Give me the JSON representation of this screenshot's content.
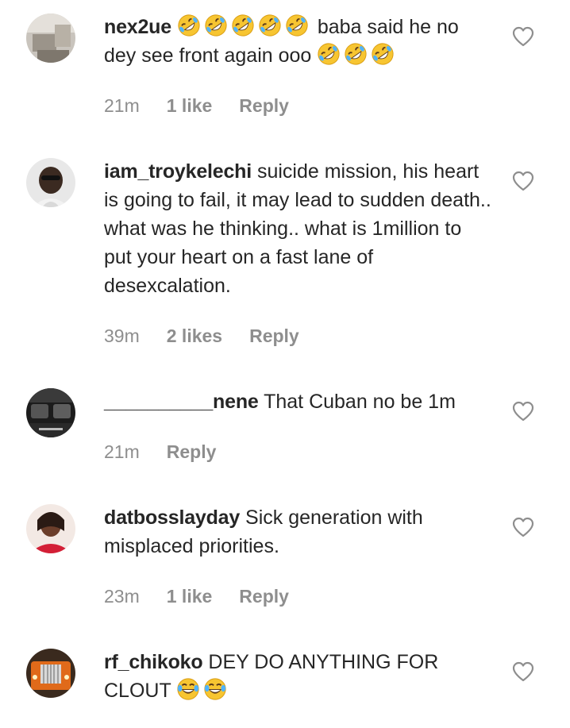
{
  "comments": [
    {
      "username": "nex2ue",
      "text_before": "baba said he no dey see front again ooo",
      "leading_emojis": [
        "rofl",
        "rofl",
        "rofl",
        "rofl",
        "rofl"
      ],
      "trailing_emojis": [
        "rofl",
        "rofl",
        "rofl"
      ],
      "time": "21m",
      "likes": "1 like",
      "reply": "Reply"
    },
    {
      "username": "iam_troykelechi",
      "text": "suicide mission, his heart is going to fail, it may lead to sudden death.. what was he thinking.. what is 1million to put your heart on a fast lane of desexcalation.",
      "time": "39m",
      "likes": "2 likes",
      "reply": "Reply"
    },
    {
      "username": "__________nene",
      "text": "That Cuban no be 1m",
      "time": "21m",
      "reply": "Reply"
    },
    {
      "username": "datbosslayday",
      "text": "Sick generation with misplaced priorities.",
      "time": "23m",
      "likes": "1 like",
      "reply": "Reply"
    },
    {
      "username": "rf_chikoko",
      "text": "DEY DO ANYTHING FOR CLOUT",
      "trailing_emojis": [
        "joy",
        "joy"
      ],
      "time": "",
      "reply": ""
    }
  ],
  "icons": {
    "like": "heart-outline-icon",
    "rofl": "rolling-on-floor-laughing-emoji",
    "joy": "face-with-tears-of-joy-emoji"
  },
  "colors": {
    "text": "#262626",
    "meta": "#8e8e8e",
    "heart_stroke": "#8e8e8e",
    "emoji_face": "#f7c531"
  }
}
